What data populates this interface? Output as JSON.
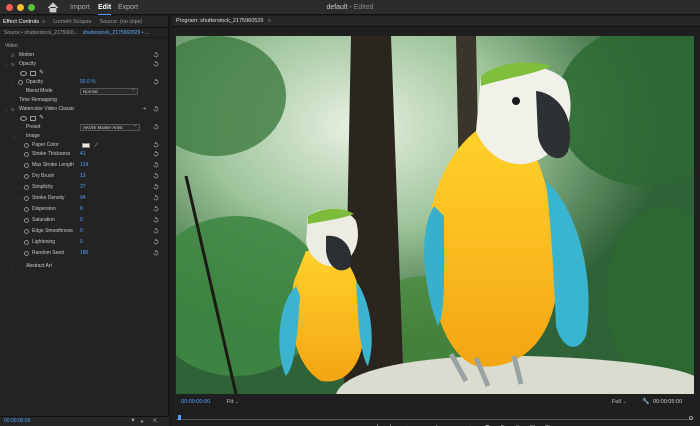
{
  "titlebar": {
    "tabs": [
      "Import",
      "Edit",
      "Export"
    ],
    "active_tab": "Edit",
    "doc_title": "default",
    "doc_status": "Edited"
  },
  "left_panel": {
    "tabs": [
      "Effect Controls",
      "Lumetri Scopes",
      "Source: (no clips)"
    ],
    "source_label": "Source • shutterstock_2175960...",
    "clip_label": "shutterstock_2175960529 • ...",
    "section_video": "Video",
    "motion": "Motion",
    "opacity": "Opacity",
    "opacity_param": "Opacity",
    "opacity_value": "90.0 %",
    "blend_mode_label": "Blend Mode",
    "blend_mode_value": "Normal",
    "time_remapping": "Time Remapping",
    "watercolor": "Watercolor Video Classic",
    "preset_label": "Preset",
    "preset_value": "AKVIS Master Artist",
    "image_label": "Image",
    "paper_color_label": "Paper Color",
    "params": [
      {
        "label": "Stroke Thickness",
        "value": "41"
      },
      {
        "label": "Max Stroke Length",
        "value": "124"
      },
      {
        "label": "Dry Brush",
        "value": "13"
      },
      {
        "label": "Simplicity",
        "value": "37"
      },
      {
        "label": "Stroke Density",
        "value": "94"
      },
      {
        "label": "Dispersion",
        "value": "8"
      },
      {
        "label": "Saturation",
        "value": "0"
      },
      {
        "label": "Edge Smoothness",
        "value": "0"
      },
      {
        "label": "Lightening",
        "value": "0"
      },
      {
        "label": "Random Seed",
        "value": "180"
      }
    ],
    "abstract_art": "Abstract Art",
    "timecode": "00:00:00:00"
  },
  "program": {
    "title": "Program: shutterstock_2175960529",
    "timecode_left": "00:00:00:00",
    "fit": "Fit",
    "resolution": "Full",
    "timecode_right": "00:00:05:00"
  },
  "icons": {
    "reset": "reset-icon",
    "stopwatch": "stopwatch-icon",
    "pen": "pen-icon",
    "eyedropper": "eyedropper-icon"
  }
}
